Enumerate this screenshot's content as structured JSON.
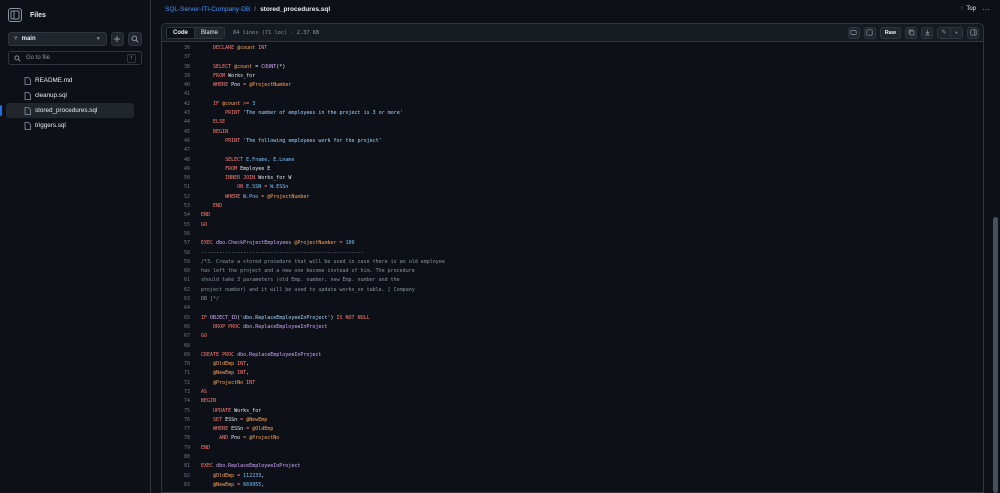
{
  "sidebar": {
    "title": "Files",
    "branch": "main",
    "goto_placeholder": "Go to file",
    "goto_kbd": "t",
    "files": [
      {
        "name": "README.md"
      },
      {
        "name": "cleanup.sql"
      },
      {
        "name": "stored_procedures.sql"
      },
      {
        "name": "triggers.sql"
      }
    ]
  },
  "header": {
    "repo": "SQL-Server-ITI-Company-DB",
    "separator": "/",
    "file": "stored_procedures.sql",
    "top_label": "Top"
  },
  "file_header": {
    "code_tab": "Code",
    "blame_tab": "Blame",
    "meta": "84 lines (71 loc) · 2.37 KB",
    "raw_label": "Raw"
  },
  "code": [
    {
      "n": "36",
      "t": [
        [
          "    ",
          ""
        ],
        [
          "DECLARE",
          "kw"
        ],
        [
          " @count ",
          "var"
        ],
        [
          "INT",
          "kw"
        ]
      ]
    },
    {
      "n": "37",
      "t": [
        [
          "",
          ""
        ]
      ]
    },
    {
      "n": "38",
      "t": [
        [
          "    ",
          ""
        ],
        [
          "SELECT",
          "kw"
        ],
        [
          " @count ",
          "var"
        ],
        [
          "= ",
          ""
        ],
        [
          "COUNT",
          "fn"
        ],
        [
          "(*)",
          ""
        ]
      ]
    },
    {
      "n": "39",
      "t": [
        [
          "    ",
          ""
        ],
        [
          "FROM",
          "kw"
        ],
        [
          " Works_for",
          ""
        ]
      ]
    },
    {
      "n": "40",
      "t": [
        [
          "    ",
          ""
        ],
        [
          "WHERE",
          "kw"
        ],
        [
          " Pno ",
          ""
        ],
        [
          "=",
          "kw"
        ],
        [
          " @ProjectNumber",
          "var"
        ]
      ]
    },
    {
      "n": "41",
      "t": [
        [
          "",
          ""
        ]
      ]
    },
    {
      "n": "42",
      "t": [
        [
          "    ",
          ""
        ],
        [
          "IF",
          "kw"
        ],
        [
          " @count ",
          "var"
        ],
        [
          ">= ",
          "kw"
        ],
        [
          "3",
          "num"
        ]
      ]
    },
    {
      "n": "43",
      "t": [
        [
          "        ",
          ""
        ],
        [
          "PRINT",
          "kw"
        ],
        [
          " ",
          ""
        ],
        [
          "'The number of employees in the project is 3 or more'",
          "str"
        ]
      ]
    },
    {
      "n": "44",
      "t": [
        [
          "    ",
          ""
        ],
        [
          "ELSE",
          "kw"
        ]
      ]
    },
    {
      "n": "45",
      "t": [
        [
          "    ",
          ""
        ],
        [
          "BEGIN",
          "kw"
        ]
      ]
    },
    {
      "n": "46",
      "t": [
        [
          "        ",
          ""
        ],
        [
          "PRINT",
          "kw"
        ],
        [
          " ",
          ""
        ],
        [
          "'The following employees work for the project'",
          "str"
        ]
      ]
    },
    {
      "n": "47",
      "t": [
        [
          "",
          ""
        ]
      ]
    },
    {
      "n": "48",
      "t": [
        [
          "        ",
          ""
        ],
        [
          "SELECT",
          "kw"
        ],
        [
          " E.Fname, E.Lname",
          "nm"
        ]
      ]
    },
    {
      "n": "49",
      "t": [
        [
          "        ",
          ""
        ],
        [
          "FROM",
          "kw"
        ],
        [
          " Employee E",
          ""
        ]
      ]
    },
    {
      "n": "50",
      "t": [
        [
          "        ",
          ""
        ],
        [
          "INNER JOIN",
          "kw"
        ],
        [
          " Works_for W",
          ""
        ]
      ]
    },
    {
      "n": "51",
      "t": [
        [
          "            ",
          ""
        ],
        [
          "ON",
          "kw"
        ],
        [
          " E.SSN ",
          "nm"
        ],
        [
          "=",
          "kw"
        ],
        [
          " W.ESSn",
          "nm"
        ]
      ]
    },
    {
      "n": "52",
      "t": [
        [
          "        ",
          ""
        ],
        [
          "WHERE",
          "kw"
        ],
        [
          " W.Pno ",
          "nm"
        ],
        [
          "=",
          "kw"
        ],
        [
          " @ProjectNumber",
          "var"
        ]
      ]
    },
    {
      "n": "53",
      "t": [
        [
          "    ",
          ""
        ],
        [
          "END",
          "kw"
        ]
      ]
    },
    {
      "n": "54",
      "t": [
        [
          "",
          ""
        ],
        [
          "END",
          "kw"
        ]
      ]
    },
    {
      "n": "55",
      "t": [
        [
          "",
          ""
        ],
        [
          "GO",
          "kw"
        ]
      ]
    },
    {
      "n": "56",
      "t": [
        [
          "",
          ""
        ]
      ]
    },
    {
      "n": "57",
      "t": [
        [
          "",
          ""
        ],
        [
          "EXEC",
          "kw"
        ],
        [
          " dbo.CheckProjectEmployees",
          "fn"
        ],
        [
          " @ProjectNumber ",
          "var"
        ],
        [
          "= ",
          "kw"
        ],
        [
          "100",
          "num"
        ]
      ]
    },
    {
      "n": "58",
      "t": [
        [
          "------------------------------------------------------",
          "cm"
        ]
      ]
    },
    {
      "n": "59",
      "t": [
        [
          "/*3. Create a stored procedure that will be used in case there is an old employee",
          "cm"
        ]
      ]
    },
    {
      "n": "60",
      "t": [
        [
          "has left the project and a new one become instead of him. The procedure",
          "cm"
        ]
      ]
    },
    {
      "n": "61",
      "t": [
        [
          "should take 3 parameters (old Emp. number, new Emp. number and the",
          "cm"
        ]
      ]
    },
    {
      "n": "62",
      "t": [
        [
          "project number) and it will be used to update works_on table. [ Company",
          "cm"
        ]
      ]
    },
    {
      "n": "63",
      "t": [
        [
          "DB ]*/",
          "cm"
        ]
      ]
    },
    {
      "n": "64",
      "t": [
        [
          "",
          ""
        ]
      ]
    },
    {
      "n": "65",
      "t": [
        [
          "",
          ""
        ],
        [
          "IF",
          "kw"
        ],
        [
          " OBJECT_ID",
          "fn"
        ],
        [
          "(",
          ""
        ],
        [
          "'dbo.ReplaceEmployeeInProject'",
          "str"
        ],
        [
          ") ",
          ""
        ],
        [
          "IS NOT NULL",
          "kw"
        ]
      ]
    },
    {
      "n": "66",
      "t": [
        [
          "    ",
          ""
        ],
        [
          "DROP PROC",
          "kw"
        ],
        [
          " dbo.ReplaceEmployeeInProject",
          "fn"
        ]
      ]
    },
    {
      "n": "67",
      "t": [
        [
          "",
          ""
        ],
        [
          "GO",
          "kw"
        ]
      ]
    },
    {
      "n": "68",
      "t": [
        [
          "",
          ""
        ]
      ]
    },
    {
      "n": "69",
      "t": [
        [
          "",
          ""
        ],
        [
          "CREATE PROC",
          "kw"
        ],
        [
          " dbo.ReplaceEmployeeInProject",
          "fn"
        ]
      ]
    },
    {
      "n": "70",
      "t": [
        [
          "    ",
          ""
        ],
        [
          "@OldEmp ",
          "var"
        ],
        [
          "INT",
          "kw"
        ],
        [
          ",",
          ""
        ]
      ]
    },
    {
      "n": "71",
      "t": [
        [
          "    ",
          ""
        ],
        [
          "@NewEmp ",
          "var"
        ],
        [
          "INT",
          "kw"
        ],
        [
          ",",
          ""
        ]
      ]
    },
    {
      "n": "72",
      "t": [
        [
          "    ",
          ""
        ],
        [
          "@ProjectNo ",
          "var"
        ],
        [
          "INT",
          "kw"
        ]
      ]
    },
    {
      "n": "73",
      "t": [
        [
          "",
          ""
        ],
        [
          "AS",
          "kw"
        ]
      ]
    },
    {
      "n": "74",
      "t": [
        [
          "",
          ""
        ],
        [
          "BEGIN",
          "kw"
        ]
      ]
    },
    {
      "n": "75",
      "t": [
        [
          "    ",
          ""
        ],
        [
          "UPDATE",
          "kw"
        ],
        [
          " Works_for",
          ""
        ]
      ]
    },
    {
      "n": "76",
      "t": [
        [
          "    ",
          ""
        ],
        [
          "SET",
          "kw"
        ],
        [
          " ESSn ",
          ""
        ],
        [
          "=",
          "kw"
        ],
        [
          " @NewEmp",
          "var"
        ]
      ]
    },
    {
      "n": "77",
      "t": [
        [
          "    ",
          ""
        ],
        [
          "WHERE",
          "kw"
        ],
        [
          " ESSn ",
          ""
        ],
        [
          "=",
          "kw"
        ],
        [
          " @OldEmp",
          "var"
        ]
      ]
    },
    {
      "n": "78",
      "t": [
        [
          "      ",
          ""
        ],
        [
          "AND",
          "kw"
        ],
        [
          " Pno ",
          ""
        ],
        [
          "=",
          "kw"
        ],
        [
          " @ProjectNo",
          "var"
        ]
      ]
    },
    {
      "n": "79",
      "t": [
        [
          "",
          ""
        ],
        [
          "END",
          "kw"
        ]
      ]
    },
    {
      "n": "80",
      "t": [
        [
          "",
          ""
        ]
      ]
    },
    {
      "n": "81",
      "t": [
        [
          "",
          ""
        ],
        [
          "EXEC",
          "kw"
        ],
        [
          " dbo.ReplaceEmployeeInProject",
          "fn"
        ]
      ]
    },
    {
      "n": "82",
      "t": [
        [
          "    ",
          ""
        ],
        [
          "@OldEmp ",
          "var"
        ],
        [
          "= ",
          "kw"
        ],
        [
          "112233",
          "num"
        ],
        [
          ",",
          ""
        ]
      ]
    },
    {
      "n": "83",
      "t": [
        [
          "    ",
          ""
        ],
        [
          "@NewEmp ",
          "var"
        ],
        [
          "= ",
          "kw"
        ],
        [
          "669955",
          "num"
        ],
        [
          ",",
          ""
        ]
      ]
    }
  ]
}
